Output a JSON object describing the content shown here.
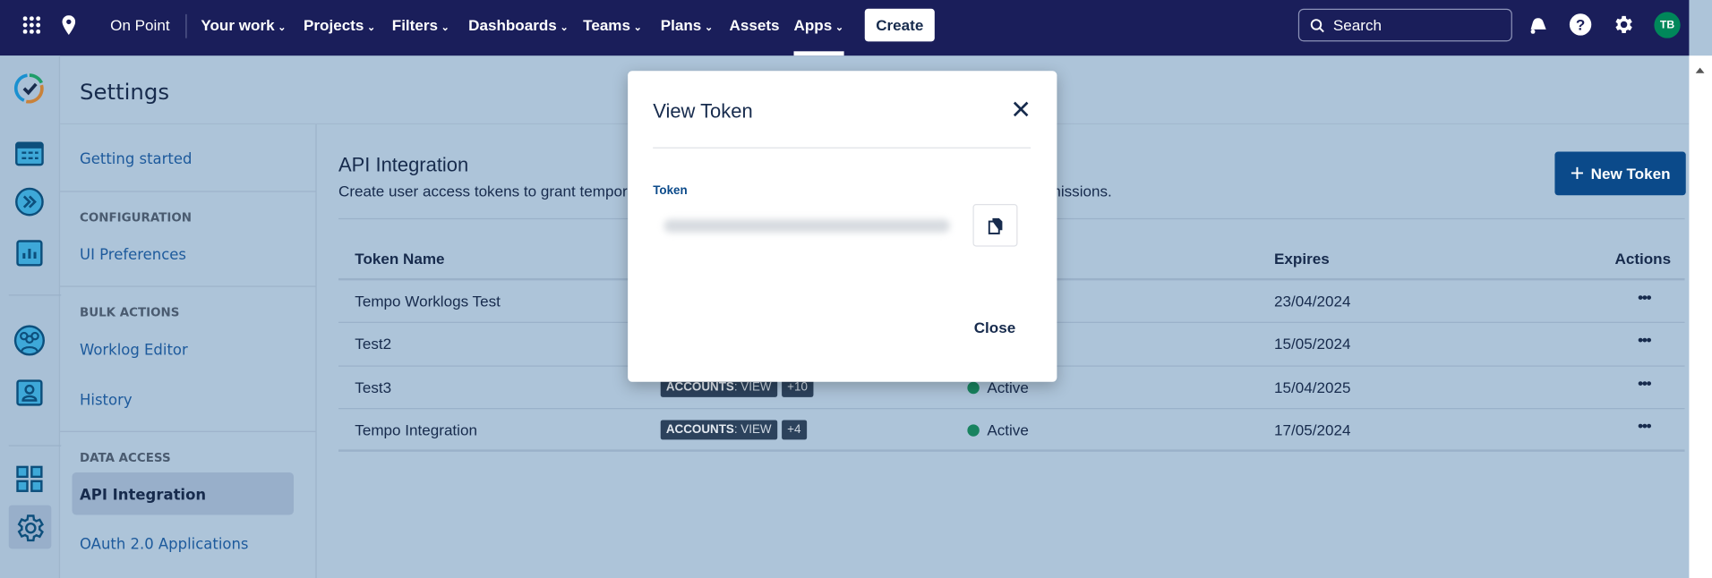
{
  "nav": {
    "site": "On Point",
    "items": [
      {
        "label": "Your work",
        "chev": true
      },
      {
        "label": "Projects",
        "chev": true
      },
      {
        "label": "Filters",
        "chev": true
      },
      {
        "label": "Dashboards",
        "chev": true
      },
      {
        "label": "Teams",
        "chev": true
      },
      {
        "label": "Plans",
        "chev": true
      },
      {
        "label": "Assets",
        "chev": false
      },
      {
        "label": "Apps",
        "chev": true,
        "active": true
      }
    ],
    "create": "Create",
    "search_placeholder": "Search",
    "avatar": "TB",
    "avatar_color": "#00875a"
  },
  "sidebar": {
    "title": "Settings",
    "getting_started": "Getting started",
    "sections": [
      {
        "heading": "CONFIGURATION",
        "items": [
          "UI Preferences"
        ]
      },
      {
        "heading": "BULK ACTIONS",
        "items": [
          "Worklog Editor",
          "History"
        ]
      },
      {
        "heading": "DATA ACCESS",
        "items": [
          "API Integration",
          "OAuth 2.0 Applications"
        ]
      }
    ],
    "selected": "API Integration"
  },
  "main": {
    "title": "API Integration",
    "desc_start": "Create user access tokens to grant temporar",
    "desc_end": "missions.",
    "new_token": "New Token",
    "columns": {
      "name": "Token Name",
      "expires": "Expires",
      "actions": "Actions"
    },
    "rows": [
      {
        "name": "Tempo Worklogs Test",
        "expires": "23/04/2024"
      },
      {
        "name": "Test2",
        "expires": "15/05/2024"
      },
      {
        "name": "Test3",
        "scope_key": "ACCOUNTS",
        "scope_val": ": VIEW",
        "extra": "+10",
        "status": "Active",
        "expires": "15/04/2025"
      },
      {
        "name": "Tempo Integration",
        "scope_key": "ACCOUNTS",
        "scope_val": ": VIEW",
        "extra": "+4",
        "status": "Active",
        "expires": "17/05/2024"
      }
    ]
  },
  "modal": {
    "title": "View Token",
    "token_label": "Token",
    "close": "Close"
  }
}
